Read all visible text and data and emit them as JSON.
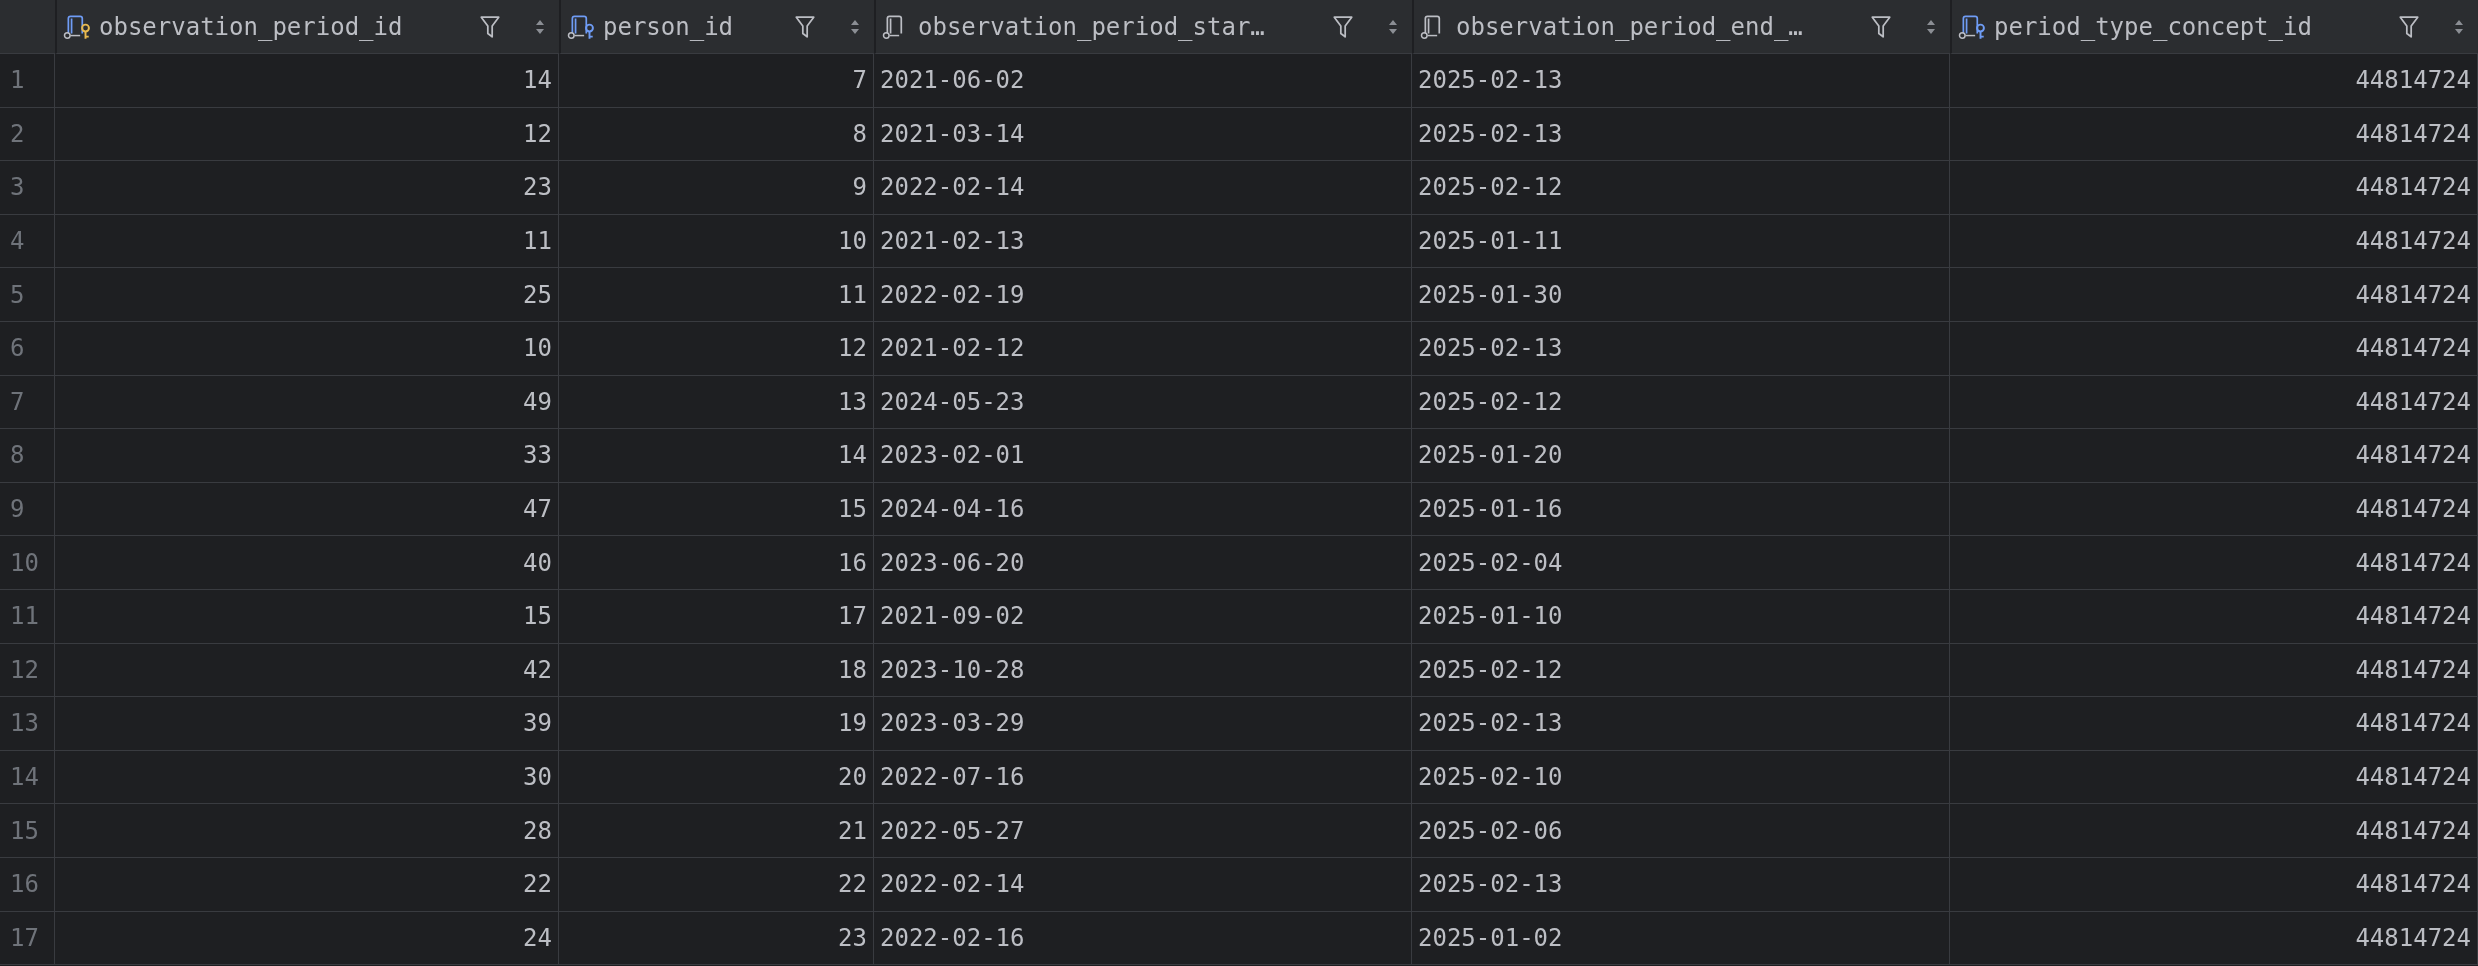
{
  "table": {
    "columns": [
      {
        "label": "observation_period_id",
        "kind": "primary_key"
      },
      {
        "label": "person_id",
        "kind": "foreign_key"
      },
      {
        "label": "observation_period_star…",
        "kind": "column"
      },
      {
        "label": "observation_period_end_…",
        "kind": "column"
      },
      {
        "label": "period_type_concept_id",
        "kind": "foreign_key"
      }
    ],
    "rows": [
      {
        "number": "1",
        "cells": [
          "14",
          "7",
          "2021-06-02",
          "2025-02-13",
          "44814724"
        ]
      },
      {
        "number": "2",
        "cells": [
          "12",
          "8",
          "2021-03-14",
          "2025-02-13",
          "44814724"
        ]
      },
      {
        "number": "3",
        "cells": [
          "23",
          "9",
          "2022-02-14",
          "2025-02-12",
          "44814724"
        ]
      },
      {
        "number": "4",
        "cells": [
          "11",
          "10",
          "2021-02-13",
          "2025-01-11",
          "44814724"
        ]
      },
      {
        "number": "5",
        "cells": [
          "25",
          "11",
          "2022-02-19",
          "2025-01-30",
          "44814724"
        ]
      },
      {
        "number": "6",
        "cells": [
          "10",
          "12",
          "2021-02-12",
          "2025-02-13",
          "44814724"
        ]
      },
      {
        "number": "7",
        "cells": [
          "49",
          "13",
          "2024-05-23",
          "2025-02-12",
          "44814724"
        ]
      },
      {
        "number": "8",
        "cells": [
          "33",
          "14",
          "2023-02-01",
          "2025-01-20",
          "44814724"
        ]
      },
      {
        "number": "9",
        "cells": [
          "47",
          "15",
          "2024-04-16",
          "2025-01-16",
          "44814724"
        ]
      },
      {
        "number": "10",
        "cells": [
          "40",
          "16",
          "2023-06-20",
          "2025-02-04",
          "44814724"
        ]
      },
      {
        "number": "11",
        "cells": [
          "15",
          "17",
          "2021-09-02",
          "2025-01-10",
          "44814724"
        ]
      },
      {
        "number": "12",
        "cells": [
          "42",
          "18",
          "2023-10-28",
          "2025-02-12",
          "44814724"
        ]
      },
      {
        "number": "13",
        "cells": [
          "39",
          "19",
          "2023-03-29",
          "2025-02-13",
          "44814724"
        ]
      },
      {
        "number": "14",
        "cells": [
          "30",
          "20",
          "2022-07-16",
          "2025-02-10",
          "44814724"
        ]
      },
      {
        "number": "15",
        "cells": [
          "28",
          "21",
          "2022-05-27",
          "2025-02-06",
          "44814724"
        ]
      },
      {
        "number": "16",
        "cells": [
          "22",
          "22",
          "2022-02-14",
          "2025-02-13",
          "44814724"
        ]
      },
      {
        "number": "17",
        "cells": [
          "24",
          "23",
          "2022-02-16",
          "2025-01-02",
          "44814724"
        ]
      }
    ]
  }
}
